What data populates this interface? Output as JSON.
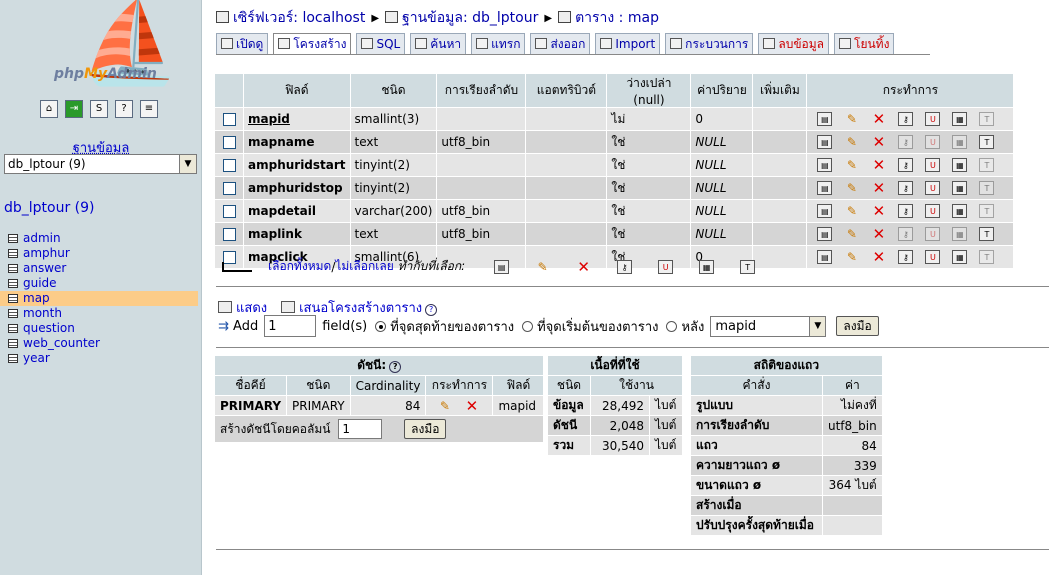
{
  "app": {
    "logo_pre": "php",
    "logo_my": "My",
    "logo_post": "Admin"
  },
  "sidebar": {
    "db_label": "ฐานข้อมูล",
    "db_select": "db_lptour (9)",
    "db_name": "db_lptour (9)",
    "tables": [
      "admin",
      "amphur",
      "answer",
      "guide",
      "map",
      "month",
      "question",
      "web_counter",
      "year"
    ],
    "active_table": "map"
  },
  "breadcrumb": {
    "server": "เซิร์ฟเวอร์: localhost",
    "database": "ฐานข้อมูล: db_lptour",
    "table": "ตาราง : map"
  },
  "tabs": [
    {
      "label": "เปิดดู",
      "active": false,
      "red": false
    },
    {
      "label": "โครงสร้าง",
      "active": true,
      "red": false
    },
    {
      "label": "SQL",
      "active": false,
      "red": false
    },
    {
      "label": "ค้นหา",
      "active": false,
      "red": false
    },
    {
      "label": "แทรก",
      "active": false,
      "red": false
    },
    {
      "label": "ส่งออก",
      "active": false,
      "red": false
    },
    {
      "label": "Import",
      "active": false,
      "red": false
    },
    {
      "label": "กระบวนการ",
      "active": false,
      "red": false
    },
    {
      "label": "ลบข้อมูล",
      "active": false,
      "red": true
    },
    {
      "label": "โยนทิ้ง",
      "active": false,
      "red": true
    }
  ],
  "structure": {
    "headers": [
      "ฟิลด์",
      "ชนิด",
      "การเรียงลำดับ",
      "แอตทริบิวต์",
      "ว่างเปล่า (null)",
      "ค่าปริยาย",
      "เพิ่มเติม",
      "กระทำการ"
    ],
    "rows": [
      {
        "field": "mapid",
        "type": "smallint(3)",
        "collation": "",
        "attributes": "",
        "null": "ไม่",
        "default": "0",
        "extra": "",
        "primary": true,
        "dim": false
      },
      {
        "field": "mapname",
        "type": "text",
        "collation": "utf8_bin",
        "attributes": "",
        "null": "ใช่",
        "default": "NULL",
        "extra": "",
        "primary": false,
        "dim": true
      },
      {
        "field": "amphuridstart",
        "type": "tinyint(2)",
        "collation": "",
        "attributes": "",
        "null": "ใช่",
        "default": "NULL",
        "extra": "",
        "primary": false,
        "dim": false
      },
      {
        "field": "amphuridstop",
        "type": "tinyint(2)",
        "collation": "",
        "attributes": "",
        "null": "ใช่",
        "default": "NULL",
        "extra": "",
        "primary": false,
        "dim": false
      },
      {
        "field": "mapdetail",
        "type": "varchar(200)",
        "collation": "utf8_bin",
        "attributes": "",
        "null": "ใช่",
        "default": "NULL",
        "extra": "",
        "primary": false,
        "dim": false
      },
      {
        "field": "maplink",
        "type": "text",
        "collation": "utf8_bin",
        "attributes": "",
        "null": "ใช่",
        "default": "NULL",
        "extra": "",
        "primary": false,
        "dim": true
      },
      {
        "field": "mapclick",
        "type": "smallint(6)",
        "collation": "",
        "attributes": "",
        "null": "ใช่",
        "default": "0",
        "extra": "",
        "primary": false,
        "dim": false
      }
    ],
    "check_all": "เลือกทั้งหมด",
    "separator": " / ",
    "uncheck_all": "ไม่เลือกเลย",
    "with_selected": "ทำกับที่เลือก:"
  },
  "links": {
    "print": "แสดง",
    "propose": "เสนอโครงสร้างตาราง"
  },
  "add_field": {
    "add_label": "Add",
    "count": "1",
    "fields_label": "field(s)",
    "at_end": "ที่จุดสุดท้ายของตาราง",
    "at_beginning": "ที่จุดเริ่มต้นของตาราง",
    "after": "หลัง",
    "after_field": "mapid",
    "go": "ลงมือ"
  },
  "indexes": {
    "title": "ดัชนี:",
    "headers": [
      "ชื่อคีย์",
      "ชนิด",
      "Cardinality",
      "กระทำการ",
      "ฟิลด์"
    ],
    "row": {
      "keyname": "PRIMARY",
      "type": "PRIMARY",
      "cardinality": "84",
      "field": "mapid"
    },
    "create_label": "สร้างดัชนีโดยคอลัมน์",
    "create_count": "1",
    "go": "ลงมือ"
  },
  "space": {
    "title": "เนื้อที่ที่ใช้",
    "headers": [
      "ชนิด",
      "ใช้งาน"
    ],
    "rows": [
      {
        "type": "ข้อมูล",
        "value": "28,492",
        "unit": "ไบต์"
      },
      {
        "type": "ดัชนี",
        "value": "2,048",
        "unit": "ไบต์"
      },
      {
        "type": "รวม",
        "value": "30,540",
        "unit": "ไบต์"
      }
    ]
  },
  "row_stats": {
    "title": "สถิติของแถว",
    "headers": [
      "คำสั่ง",
      "ค่า"
    ],
    "rows": [
      {
        "label": "รูปแบบ",
        "value": "ไม่คงที่"
      },
      {
        "label": "การเรียงลำดับ",
        "value": "utf8_bin"
      },
      {
        "label": "แถว",
        "value": "84"
      },
      {
        "label": "ความยาวแถว ø",
        "value": "339"
      },
      {
        "label": "ขนาดแถว ø",
        "value": "364 ไบต์"
      },
      {
        "label": "สร้างเมื่อ",
        "value": ""
      },
      {
        "label": "ปรับปรุงครั้งสุดท้ายเมื่อ",
        "value": ""
      }
    ]
  }
}
